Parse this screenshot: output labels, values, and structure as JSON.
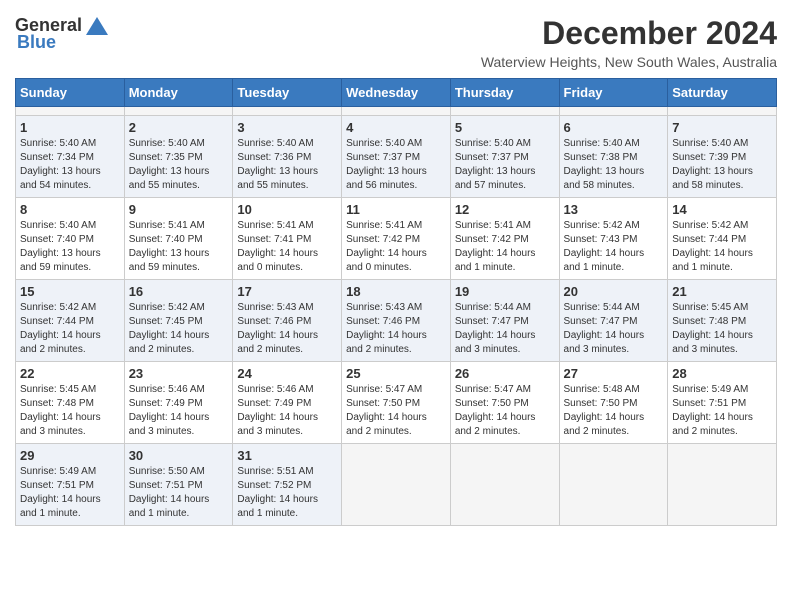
{
  "header": {
    "logo_line1": "General",
    "logo_line2": "Blue",
    "main_title": "December 2024",
    "subtitle": "Waterview Heights, New South Wales, Australia"
  },
  "calendar": {
    "headers": [
      "Sunday",
      "Monday",
      "Tuesday",
      "Wednesday",
      "Thursday",
      "Friday",
      "Saturday"
    ],
    "weeks": [
      [
        {
          "day": "",
          "empty": true
        },
        {
          "day": "",
          "empty": true
        },
        {
          "day": "",
          "empty": true
        },
        {
          "day": "",
          "empty": true
        },
        {
          "day": "",
          "empty": true
        },
        {
          "day": "",
          "empty": true
        },
        {
          "day": "",
          "empty": true
        }
      ],
      [
        {
          "day": "1",
          "info": "Sunrise: 5:40 AM\nSunset: 7:34 PM\nDaylight: 13 hours\nand 54 minutes."
        },
        {
          "day": "2",
          "info": "Sunrise: 5:40 AM\nSunset: 7:35 PM\nDaylight: 13 hours\nand 55 minutes."
        },
        {
          "day": "3",
          "info": "Sunrise: 5:40 AM\nSunset: 7:36 PM\nDaylight: 13 hours\nand 55 minutes."
        },
        {
          "day": "4",
          "info": "Sunrise: 5:40 AM\nSunset: 7:37 PM\nDaylight: 13 hours\nand 56 minutes."
        },
        {
          "day": "5",
          "info": "Sunrise: 5:40 AM\nSunset: 7:37 PM\nDaylight: 13 hours\nand 57 minutes."
        },
        {
          "day": "6",
          "info": "Sunrise: 5:40 AM\nSunset: 7:38 PM\nDaylight: 13 hours\nand 58 minutes."
        },
        {
          "day": "7",
          "info": "Sunrise: 5:40 AM\nSunset: 7:39 PM\nDaylight: 13 hours\nand 58 minutes."
        }
      ],
      [
        {
          "day": "8",
          "info": "Sunrise: 5:40 AM\nSunset: 7:40 PM\nDaylight: 13 hours\nand 59 minutes."
        },
        {
          "day": "9",
          "info": "Sunrise: 5:41 AM\nSunset: 7:40 PM\nDaylight: 13 hours\nand 59 minutes."
        },
        {
          "day": "10",
          "info": "Sunrise: 5:41 AM\nSunset: 7:41 PM\nDaylight: 14 hours\nand 0 minutes."
        },
        {
          "day": "11",
          "info": "Sunrise: 5:41 AM\nSunset: 7:42 PM\nDaylight: 14 hours\nand 0 minutes."
        },
        {
          "day": "12",
          "info": "Sunrise: 5:41 AM\nSunset: 7:42 PM\nDaylight: 14 hours\nand 1 minute."
        },
        {
          "day": "13",
          "info": "Sunrise: 5:42 AM\nSunset: 7:43 PM\nDaylight: 14 hours\nand 1 minute."
        },
        {
          "day": "14",
          "info": "Sunrise: 5:42 AM\nSunset: 7:44 PM\nDaylight: 14 hours\nand 1 minute."
        }
      ],
      [
        {
          "day": "15",
          "info": "Sunrise: 5:42 AM\nSunset: 7:44 PM\nDaylight: 14 hours\nand 2 minutes."
        },
        {
          "day": "16",
          "info": "Sunrise: 5:42 AM\nSunset: 7:45 PM\nDaylight: 14 hours\nand 2 minutes."
        },
        {
          "day": "17",
          "info": "Sunrise: 5:43 AM\nSunset: 7:46 PM\nDaylight: 14 hours\nand 2 minutes."
        },
        {
          "day": "18",
          "info": "Sunrise: 5:43 AM\nSunset: 7:46 PM\nDaylight: 14 hours\nand 2 minutes."
        },
        {
          "day": "19",
          "info": "Sunrise: 5:44 AM\nSunset: 7:47 PM\nDaylight: 14 hours\nand 3 minutes."
        },
        {
          "day": "20",
          "info": "Sunrise: 5:44 AM\nSunset: 7:47 PM\nDaylight: 14 hours\nand 3 minutes."
        },
        {
          "day": "21",
          "info": "Sunrise: 5:45 AM\nSunset: 7:48 PM\nDaylight: 14 hours\nand 3 minutes."
        }
      ],
      [
        {
          "day": "22",
          "info": "Sunrise: 5:45 AM\nSunset: 7:48 PM\nDaylight: 14 hours\nand 3 minutes."
        },
        {
          "day": "23",
          "info": "Sunrise: 5:46 AM\nSunset: 7:49 PM\nDaylight: 14 hours\nand 3 minutes."
        },
        {
          "day": "24",
          "info": "Sunrise: 5:46 AM\nSunset: 7:49 PM\nDaylight: 14 hours\nand 3 minutes."
        },
        {
          "day": "25",
          "info": "Sunrise: 5:47 AM\nSunset: 7:50 PM\nDaylight: 14 hours\nand 2 minutes."
        },
        {
          "day": "26",
          "info": "Sunrise: 5:47 AM\nSunset: 7:50 PM\nDaylight: 14 hours\nand 2 minutes."
        },
        {
          "day": "27",
          "info": "Sunrise: 5:48 AM\nSunset: 7:50 PM\nDaylight: 14 hours\nand 2 minutes."
        },
        {
          "day": "28",
          "info": "Sunrise: 5:49 AM\nSunset: 7:51 PM\nDaylight: 14 hours\nand 2 minutes."
        }
      ],
      [
        {
          "day": "29",
          "info": "Sunrise: 5:49 AM\nSunset: 7:51 PM\nDaylight: 14 hours\nand 1 minute."
        },
        {
          "day": "30",
          "info": "Sunrise: 5:50 AM\nSunset: 7:51 PM\nDaylight: 14 hours\nand 1 minute."
        },
        {
          "day": "31",
          "info": "Sunrise: 5:51 AM\nSunset: 7:52 PM\nDaylight: 14 hours\nand 1 minute."
        },
        {
          "day": "",
          "empty": true
        },
        {
          "day": "",
          "empty": true
        },
        {
          "day": "",
          "empty": true
        },
        {
          "day": "",
          "empty": true
        }
      ]
    ]
  }
}
